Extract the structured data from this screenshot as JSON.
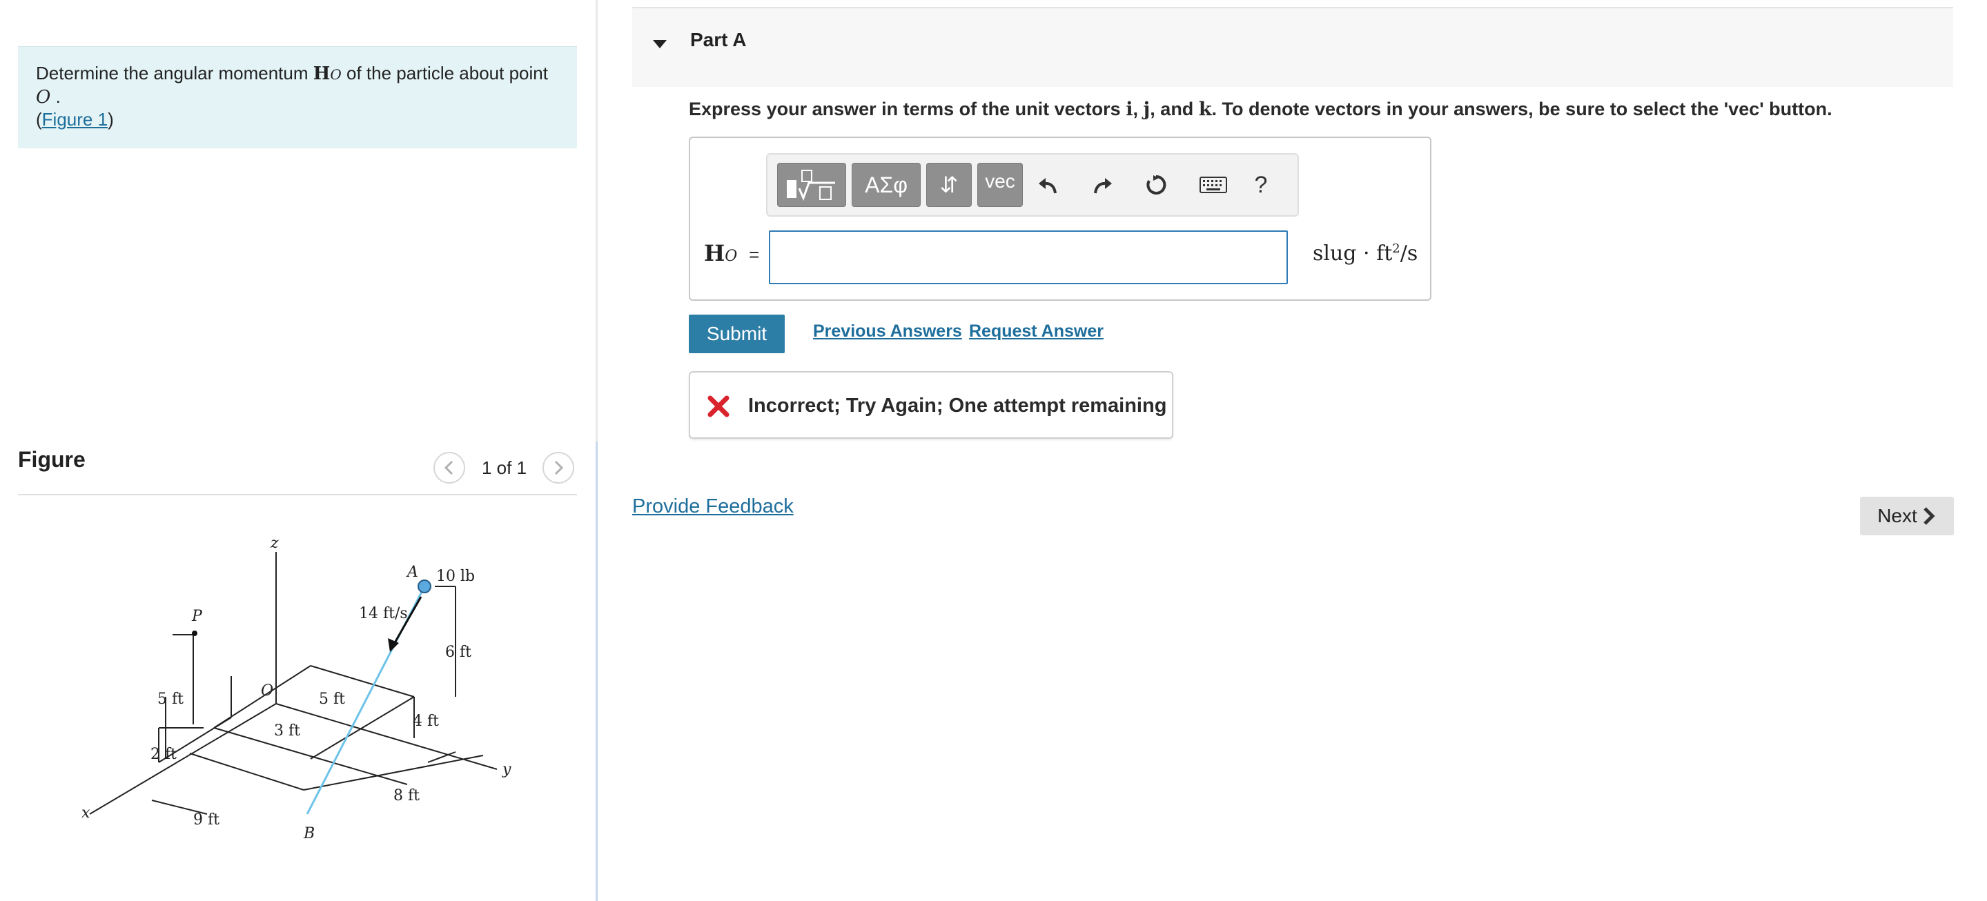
{
  "problem": {
    "prompt_prefix": "Determine the angular momentum",
    "prompt_symbol": "H",
    "prompt_subscript": "O",
    "prompt_suffix": "of the particle about point",
    "point_name": "O",
    "point_period": ".",
    "figure_link_open": "(",
    "figure_link": "Figure 1",
    "figure_link_close": ")"
  },
  "figure_panel": {
    "title": "Figure",
    "pager": "1 of 1",
    "labels": {
      "z": "z",
      "x": "x",
      "y": "y",
      "P": "P",
      "O": "O",
      "A": "A",
      "B": "B",
      "force": "10 lb",
      "velocity": "14 ft/s",
      "d5ft_left": "5 ft",
      "d2ft": "2 ft",
      "d3ft": "3 ft",
      "d5ft_mid": "5 ft",
      "d4ft": "4 ft",
      "d6ft": "6 ft",
      "d9ft": "9 ft",
      "d8ft": "8 ft"
    }
  },
  "part": {
    "title": "Part A"
  },
  "instructions": {
    "text1": "Express your answer in terms of the unit vectors",
    "i": "i",
    "comma1": ",",
    "j": "j",
    "and": ", and",
    "k": "k",
    "text2": ". To denote vectors in your answers, be sure to select the 'vec' button."
  },
  "answer": {
    "label_symbol": "H",
    "label_sub": "O",
    "equals": "=",
    "value": "",
    "units_prefix": "slug · ft",
    "units_exp": "2",
    "units_suffix": "/s"
  },
  "toolbar": {
    "greek": "ΑΣφ",
    "arrows": "⇵",
    "vec": "vec",
    "help": "?"
  },
  "actions": {
    "submit": "Submit",
    "previous_answers": "Previous Answers",
    "request_answer": "Request Answer"
  },
  "feedback": {
    "message": "Incorrect; Try Again; One attempt remaining"
  },
  "footer": {
    "provide_feedback": "Provide Feedback",
    "next": "Next"
  },
  "colors": {
    "accent": "#2d7ea7",
    "link": "#1e6e9c",
    "error": "#d9232d",
    "prompt_bg": "#e4f4f6"
  }
}
